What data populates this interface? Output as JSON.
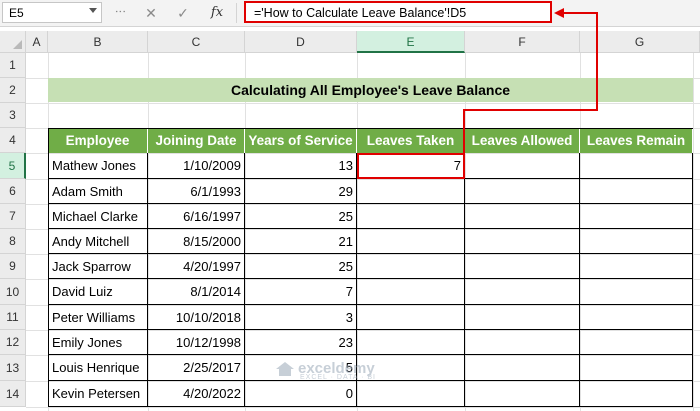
{
  "formula_bar": {
    "name_box": "E5",
    "cancel_symbol": "✕",
    "enter_symbol": "✓",
    "fx_label": "fx",
    "formula": "='How to Calculate Leave Balance'!D5"
  },
  "columns": [
    "A",
    "B",
    "C",
    "D",
    "E",
    "F",
    "G"
  ],
  "rows": [
    "1",
    "2",
    "3",
    "4",
    "5",
    "6",
    "7",
    "8",
    "9",
    "10",
    "11",
    "12",
    "13",
    "14"
  ],
  "selected_cell": {
    "column": "E",
    "row": "5"
  },
  "sheet": {
    "title": "Calculating All Employee's Leave Balance",
    "headers": [
      "Employee",
      "Joining Date",
      "Years of Service",
      "Leaves Taken",
      "Leaves Allowed",
      "Leaves Remain"
    ],
    "data": [
      {
        "employee": "Mathew Jones",
        "joining": "1/10/2009",
        "years": "13",
        "taken": "7"
      },
      {
        "employee": "Adam Smith",
        "joining": "6/1/1993",
        "years": "29",
        "taken": ""
      },
      {
        "employee": "Michael Clarke",
        "joining": "6/16/1997",
        "years": "25",
        "taken": ""
      },
      {
        "employee": "Andy Mitchell",
        "joining": "8/15/2000",
        "years": "21",
        "taken": ""
      },
      {
        "employee": "Jack Sparrow",
        "joining": "4/20/1997",
        "years": "25",
        "taken": ""
      },
      {
        "employee": "David Luiz",
        "joining": "8/1/2014",
        "years": "7",
        "taken": ""
      },
      {
        "employee": "Peter Williams",
        "joining": "10/10/2018",
        "years": "3",
        "taken": ""
      },
      {
        "employee": "Emily Jones",
        "joining": "10/12/1998",
        "years": "23",
        "taken": ""
      },
      {
        "employee": "Louis Henrique",
        "joining": "2/25/2017",
        "years": "5",
        "taken": ""
      },
      {
        "employee": "Kevin Petersen",
        "joining": "4/20/2022",
        "years": "0",
        "taken": ""
      }
    ]
  },
  "watermark": {
    "name": "exceldemy",
    "tagline": "EXCEL · DATA · BI"
  },
  "colors": {
    "header_green": "#70ad47",
    "title_green": "#c6e0b4",
    "highlight_red": "#e00000",
    "excel_green": "#217346"
  }
}
